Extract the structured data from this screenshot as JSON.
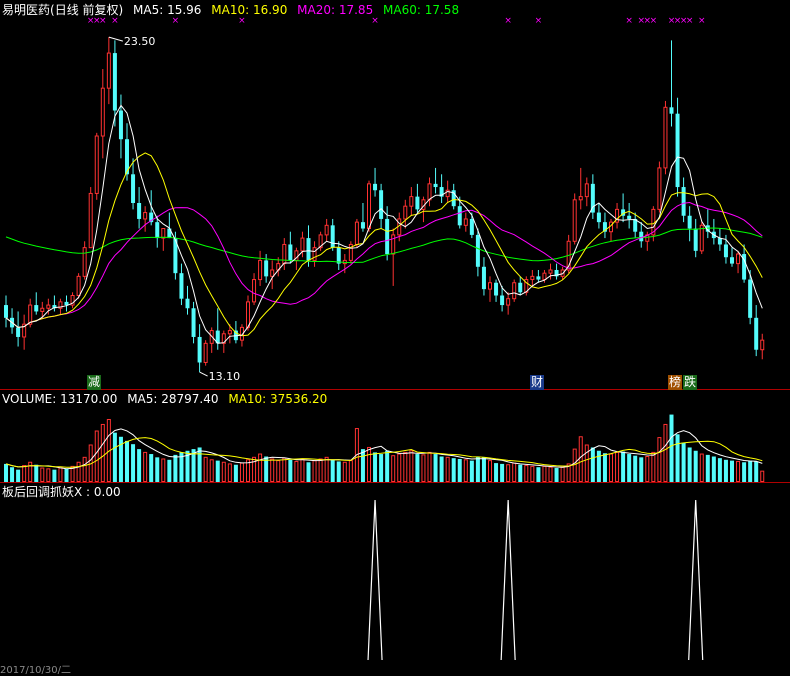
{
  "header": {
    "name": "易明医药",
    "period": "(日线 前复权)",
    "ma_labels": [
      {
        "label": "MA5: 15.96",
        "color": "#ffffff"
      },
      {
        "label": "MA10: 16.90",
        "color": "#ffff00"
      },
      {
        "label": "MA20: 17.85",
        "color": "#ff00ff"
      },
      {
        "label": "MA60: 17.58",
        "color": "#00ff00"
      }
    ]
  },
  "volume_header": {
    "items": [
      {
        "label": "VOLUME: 13170.00",
        "color": "#ffffff"
      },
      {
        "label": "MA5: 28797.40",
        "color": "#ffffff"
      },
      {
        "label": "MA10: 37536.20",
        "color": "#ffff00"
      }
    ]
  },
  "indicator_header": {
    "label": "板后回调抓妖X : 0.00"
  },
  "annotations": {
    "high_label": "23.50",
    "low_label": "13.10",
    "tag_jian": "减",
    "tag_cai": "财",
    "tag_bang": "榜",
    "tag_die": "跌"
  },
  "bottom_date": "2017/10/30/二",
  "colors": {
    "background": "#000000",
    "up": "#ff3232",
    "down": "#54fcfc",
    "ma5": "#ffffff",
    "ma10": "#ffff00",
    "ma20": "#ff00ff",
    "ma60": "#00ff00",
    "panel_border": "#b00000",
    "marker": "#ff00ff"
  },
  "chart_data": [
    {
      "type": "candlestick",
      "title": "易明医药(日线 前复权)",
      "ylim": [
        12.6,
        24.2
      ],
      "annotations": [
        {
          "label": "23.50",
          "y": 23.5
        },
        {
          "label": "13.10",
          "y": 13.1
        }
      ],
      "ohlc": [
        [
          15.2,
          15.5,
          14.5,
          14.8
        ],
        [
          14.8,
          15.1,
          14.3,
          14.5
        ],
        [
          14.5,
          15.0,
          13.9,
          14.2
        ],
        [
          14.2,
          14.9,
          13.8,
          14.6
        ],
        [
          14.6,
          15.4,
          14.5,
          15.2
        ],
        [
          15.2,
          15.6,
          14.9,
          15.0
        ],
        [
          15.0,
          15.3,
          14.8,
          15.1
        ],
        [
          15.1,
          15.4,
          14.9,
          15.2
        ],
        [
          15.2,
          15.5,
          15.0,
          15.1
        ],
        [
          15.1,
          15.4,
          14.9,
          15.3
        ],
        [
          15.3,
          15.5,
          15.0,
          15.2
        ],
        [
          15.2,
          15.6,
          15.1,
          15.5
        ],
        [
          15.5,
          16.2,
          15.4,
          16.1
        ],
        [
          16.1,
          17.2,
          16.0,
          17.0
        ],
        [
          17.0,
          18.9,
          17.0,
          18.7
        ],
        [
          18.7,
          20.6,
          18.5,
          20.5
        ],
        [
          20.5,
          22.6,
          19.8,
          22.0
        ],
        [
          22.0,
          23.6,
          21.5,
          23.1
        ],
        [
          23.1,
          23.5,
          20.8,
          21.3
        ],
        [
          21.3,
          21.8,
          19.8,
          20.4
        ],
        [
          20.4,
          20.9,
          19.1,
          19.3
        ],
        [
          19.3,
          19.8,
          18.2,
          18.4
        ],
        [
          18.4,
          18.9,
          17.6,
          17.9
        ],
        [
          17.9,
          18.3,
          17.5,
          18.1
        ],
        [
          18.1,
          18.8,
          17.7,
          17.8
        ],
        [
          17.8,
          18.0,
          17.0,
          17.3
        ],
        [
          17.3,
          17.6,
          16.9,
          17.6
        ],
        [
          17.6,
          18.1,
          17.3,
          17.3
        ],
        [
          17.3,
          17.5,
          16.0,
          16.2
        ],
        [
          16.2,
          16.5,
          15.2,
          15.4
        ],
        [
          15.4,
          15.8,
          14.9,
          15.1
        ],
        [
          15.1,
          15.3,
          14.0,
          14.2
        ],
        [
          14.2,
          14.6,
          13.1,
          13.4
        ],
        [
          13.4,
          14.1,
          13.3,
          14.0
        ],
        [
          14.0,
          14.5,
          13.7,
          14.4
        ],
        [
          14.4,
          15.1,
          13.8,
          14.0
        ],
        [
          14.0,
          14.4,
          13.7,
          14.3
        ],
        [
          14.3,
          14.6,
          14.0,
          14.4
        ],
        [
          14.4,
          14.7,
          14.0,
          14.1
        ],
        [
          14.1,
          14.6,
          13.9,
          14.5
        ],
        [
          14.5,
          15.5,
          14.4,
          15.3
        ],
        [
          15.3,
          16.2,
          15.2,
          16.0
        ],
        [
          16.0,
          16.9,
          15.8,
          16.6
        ],
        [
          16.6,
          16.8,
          15.9,
          16.1
        ],
        [
          16.1,
          16.6,
          15.7,
          16.3
        ],
        [
          16.3,
          16.7,
          16.1,
          16.5
        ],
        [
          16.5,
          17.3,
          16.3,
          17.1
        ],
        [
          17.1,
          17.5,
          16.5,
          16.6
        ],
        [
          16.6,
          17.0,
          16.3,
          16.9
        ],
        [
          16.9,
          17.5,
          16.7,
          17.3
        ],
        [
          17.3,
          17.7,
          16.4,
          16.6
        ],
        [
          16.6,
          17.2,
          16.4,
          17.0
        ],
        [
          17.0,
          17.5,
          16.9,
          17.4
        ],
        [
          17.4,
          17.9,
          17.2,
          17.7
        ],
        [
          17.7,
          17.9,
          16.9,
          17.0
        ],
        [
          17.0,
          17.2,
          16.3,
          16.5
        ],
        [
          16.5,
          16.8,
          16.2,
          16.6
        ],
        [
          16.6,
          17.2,
          16.5,
          17.1
        ],
        [
          17.1,
          17.9,
          17.0,
          17.8
        ],
        [
          17.8,
          18.4,
          17.5,
          17.6
        ],
        [
          17.6,
          19.1,
          17.5,
          19.0
        ],
        [
          19.0,
          19.5,
          18.6,
          18.8
        ],
        [
          18.8,
          19.0,
          17.6,
          17.9
        ],
        [
          17.9,
          18.3,
          16.6,
          16.8
        ],
        [
          16.8,
          17.6,
          15.8,
          17.4
        ],
        [
          17.4,
          18.1,
          17.2,
          17.9
        ],
        [
          17.9,
          18.5,
          17.6,
          18.3
        ],
        [
          18.3,
          18.9,
          18.0,
          18.6
        ],
        [
          18.6,
          19.0,
          18.1,
          18.2
        ],
        [
          18.2,
          18.6,
          17.8,
          18.5
        ],
        [
          18.5,
          19.2,
          18.3,
          19.0
        ],
        [
          19.0,
          19.5,
          18.7,
          18.9
        ],
        [
          18.9,
          19.3,
          18.4,
          18.6
        ],
        [
          18.6,
          19.1,
          18.4,
          18.8
        ],
        [
          18.8,
          19.0,
          18.2,
          18.3
        ],
        [
          18.3,
          18.6,
          17.6,
          17.7
        ],
        [
          17.7,
          18.1,
          17.5,
          17.9
        ],
        [
          17.9,
          18.1,
          17.3,
          17.4
        ],
        [
          17.4,
          17.6,
          16.1,
          16.4
        ],
        [
          16.4,
          16.7,
          15.5,
          15.7
        ],
        [
          15.7,
          16.1,
          15.3,
          15.9
        ],
        [
          15.9,
          16.0,
          15.3,
          15.5
        ],
        [
          15.5,
          15.8,
          15.0,
          15.2
        ],
        [
          15.2,
          15.6,
          14.9,
          15.4
        ],
        [
          15.4,
          16.0,
          15.3,
          15.9
        ],
        [
          15.9,
          16.1,
          15.5,
          15.6
        ],
        [
          15.6,
          16.1,
          15.5,
          16.0
        ],
        [
          16.0,
          16.3,
          15.8,
          16.1
        ],
        [
          16.1,
          16.3,
          15.9,
          16.0
        ],
        [
          16.0,
          16.3,
          15.9,
          16.2
        ],
        [
          16.2,
          16.5,
          16.0,
          16.3
        ],
        [
          16.3,
          16.5,
          16.0,
          16.1
        ],
        [
          16.1,
          16.4,
          16.0,
          16.3
        ],
        [
          16.3,
          17.4,
          16.2,
          17.2
        ],
        [
          17.2,
          18.7,
          17.1,
          18.5
        ],
        [
          18.5,
          19.5,
          18.2,
          18.6
        ],
        [
          18.6,
          19.2,
          18.3,
          19.0
        ],
        [
          19.0,
          19.3,
          17.9,
          18.1
        ],
        [
          18.1,
          18.4,
          17.6,
          17.8
        ],
        [
          17.8,
          18.1,
          17.3,
          17.5
        ],
        [
          17.5,
          17.9,
          17.2,
          17.8
        ],
        [
          17.8,
          18.4,
          17.6,
          18.2
        ],
        [
          18.2,
          18.7,
          17.8,
          18.0
        ],
        [
          18.0,
          18.4,
          17.6,
          17.9
        ],
        [
          17.9,
          18.1,
          17.3,
          17.5
        ],
        [
          17.5,
          17.8,
          17.0,
          17.2
        ],
        [
          17.2,
          17.5,
          16.9,
          17.4
        ],
        [
          17.4,
          18.3,
          17.2,
          18.2
        ],
        [
          18.2,
          19.7,
          18.1,
          19.5
        ],
        [
          19.5,
          21.6,
          19.3,
          21.4
        ],
        [
          21.4,
          23.5,
          20.8,
          21.2
        ],
        [
          21.2,
          21.7,
          18.6,
          18.9
        ],
        [
          18.9,
          19.2,
          17.8,
          18.0
        ],
        [
          18.0,
          18.3,
          17.2,
          17.6
        ],
        [
          17.6,
          17.9,
          16.7,
          16.9
        ],
        [
          16.9,
          17.8,
          16.8,
          17.7
        ],
        [
          17.7,
          18.2,
          17.3,
          17.5
        ],
        [
          17.5,
          17.9,
          17.1,
          17.3
        ],
        [
          17.3,
          17.6,
          16.9,
          17.1
        ],
        [
          17.1,
          17.4,
          16.5,
          16.7
        ],
        [
          16.7,
          17.0,
          16.4,
          16.5
        ],
        [
          16.5,
          16.9,
          16.2,
          16.8
        ],
        [
          16.8,
          17.1,
          15.9,
          16.0
        ],
        [
          16.0,
          16.3,
          14.6,
          14.8
        ],
        [
          14.8,
          15.2,
          13.6,
          13.8
        ],
        [
          13.8,
          14.3,
          13.5,
          14.1
        ]
      ],
      "series": [
        {
          "name": "MA5",
          "value": 15.96
        },
        {
          "name": "MA10",
          "value": 16.9
        },
        {
          "name": "MA20",
          "value": 17.85
        },
        {
          "name": "MA60",
          "value": 17.58
        }
      ]
    },
    {
      "type": "bar",
      "title": "VOLUME",
      "ylim": [
        0,
        90000
      ],
      "values": [
        22000,
        18000,
        15000,
        20000,
        24000,
        21000,
        17000,
        16000,
        15000,
        17000,
        16000,
        19000,
        24000,
        30000,
        45000,
        62000,
        70000,
        76000,
        60000,
        55000,
        50000,
        46000,
        40000,
        36000,
        34000,
        30000,
        28000,
        27000,
        33000,
        36000,
        38000,
        40000,
        42000,
        30000,
        27000,
        26000,
        24000,
        22000,
        21000,
        23000,
        27000,
        30000,
        34000,
        31000,
        28000,
        26000,
        29000,
        27000,
        25000,
        28000,
        24000,
        26000,
        28000,
        30000,
        27000,
        25000,
        24000,
        26000,
        65000,
        40000,
        42000,
        36000,
        34000,
        38000,
        32000,
        34000,
        36000,
        38000,
        34000,
        33000,
        36000,
        34000,
        31000,
        30000,
        29000,
        28000,
        27000,
        26000,
        31000,
        30000,
        26000,
        23000,
        22000,
        21000,
        23000,
        21000,
        20000,
        19000,
        18000,
        19000,
        18000,
        17000,
        18000,
        22000,
        40000,
        55000,
        45000,
        42000,
        38000,
        35000,
        34000,
        36000,
        37000,
        34000,
        32000,
        30000,
        31000,
        36000,
        54000,
        70000,
        82000,
        58000,
        48000,
        42000,
        38000,
        34000,
        33000,
        31000,
        29000,
        27000,
        26000,
        25000,
        24000,
        26000,
        25000,
        13170
      ],
      "series": [
        {
          "name": "MA5",
          "value": 28797.4
        },
        {
          "name": "MA10",
          "value": 37536.2
        }
      ]
    },
    {
      "type": "line",
      "title": "板后回调抓妖X",
      "values_at": [
        {
          "x": 61,
          "y": 1
        },
        {
          "x": 83,
          "y": 1
        },
        {
          "x": 114,
          "y": 1
        }
      ],
      "current": 0.0
    }
  ]
}
